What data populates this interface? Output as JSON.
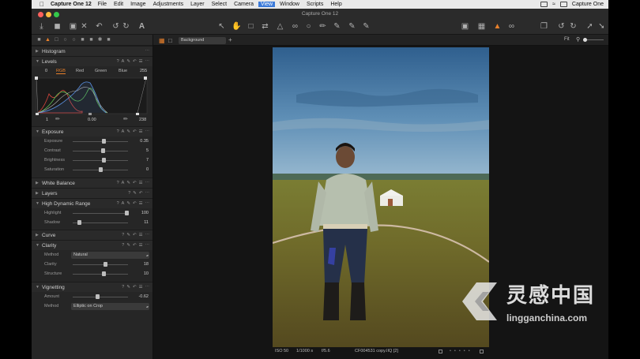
{
  "menubar": {
    "app_name": "Capture One 12",
    "items": [
      "File",
      "Edit",
      "Image",
      "Adjustments",
      "Layer",
      "Select",
      "Camera",
      "View",
      "Window",
      "Scripts",
      "Help"
    ],
    "active_item": "View",
    "right_app": "Capture One"
  },
  "window": {
    "title": "Capture One 12"
  },
  "viewer": {
    "variant": "Background",
    "zoom_label": "Fit",
    "status": {
      "iso": "ISO 50",
      "shutter": "1/1000 s",
      "aperture": "f/5.6",
      "filename": "CF004531 copy.IIQ [2]"
    }
  },
  "tools": {
    "histogram": {
      "title": "Histogram"
    },
    "levels": {
      "title": "Levels",
      "input_min": "0",
      "input_max": "255",
      "channels": [
        "RGB",
        "Red",
        "Green",
        "Blue"
      ],
      "active_channel": "RGB",
      "output_min": "1",
      "midpoint": "0.00",
      "output_max": "238"
    },
    "exposure": {
      "title": "Exposure",
      "rows": [
        {
          "label": "Exposure",
          "value": "0.35",
          "pos": 0.55
        },
        {
          "label": "Contrast",
          "value": "5",
          "pos": 0.54
        },
        {
          "label": "Brightness",
          "value": "7",
          "pos": 0.55
        },
        {
          "label": "Saturation",
          "value": "0",
          "pos": 0.5
        }
      ]
    },
    "white_balance": {
      "title": "White Balance"
    },
    "layers": {
      "title": "Layers"
    },
    "hdr": {
      "title": "High Dynamic Range",
      "rows": [
        {
          "label": "Highlight",
          "value": "100",
          "pos": 0.97
        },
        {
          "label": "Shadow",
          "value": "11",
          "pos": 0.11
        }
      ]
    },
    "curve": {
      "title": "Curve"
    },
    "clarity": {
      "title": "Clarity",
      "method_label": "Method",
      "method_value": "Natural",
      "rows": [
        {
          "label": "Clarity",
          "value": "18",
          "pos": 0.59
        },
        {
          "label": "Structure",
          "value": "10",
          "pos": 0.55
        }
      ]
    },
    "vignetting": {
      "title": "Vignetting",
      "amount_label": "Amount",
      "amount_value": "-0.62",
      "amount_pos": 0.44,
      "method_label": "Method",
      "method_value": "Elliptic on Crop"
    }
  },
  "watermark": {
    "cn": "灵感中国",
    "url": "lingganchina.com"
  },
  "colors": {
    "accent": "#e8802b",
    "panel": "#262626",
    "viewer": "#141414"
  }
}
